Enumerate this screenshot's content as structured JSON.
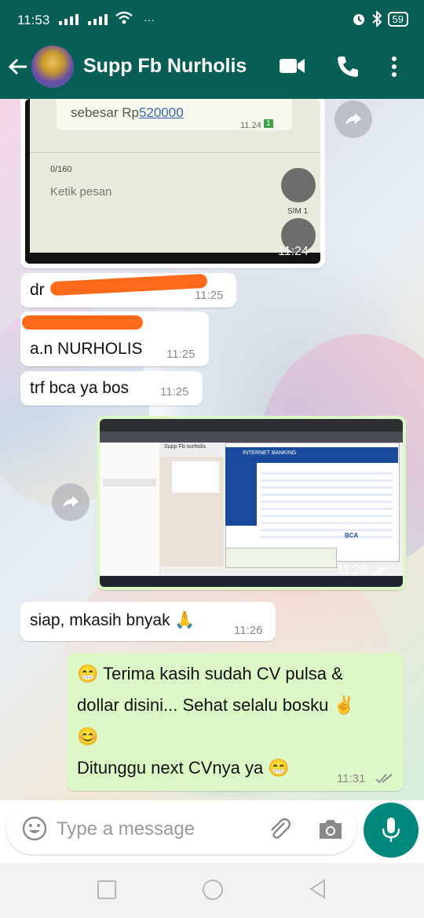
{
  "status_bar": {
    "time": "11:53",
    "battery": "59",
    "more": "···"
  },
  "header": {
    "contact_name": "Supp Fb Nurholis"
  },
  "colors": {
    "header": "#075e54",
    "outgoing_bubble": "#dcf8c6",
    "incoming_bubble": "#ffffff",
    "mic_button": "#00897b",
    "redaction": "#ff6a1a"
  },
  "messages": [
    {
      "type": "image",
      "direction": "incoming",
      "time": "11:24",
      "image_text": {
        "line1": "sebesar Rp",
        "amount": "520000",
        "msg_time": "11.24",
        "msg_badge": "1",
        "counter": "0/160",
        "placeholder": "Ketik pesan",
        "sim": "SIM 1"
      }
    },
    {
      "type": "text",
      "direction": "incoming",
      "text": "dr",
      "time": "11:25",
      "redacted": true
    },
    {
      "type": "text",
      "direction": "incoming",
      "text": "a.n NURHOLIS",
      "time": "11:25",
      "redacted": true
    },
    {
      "type": "text",
      "direction": "incoming",
      "text": "trf bca ya bos",
      "time": "11:25"
    },
    {
      "type": "image",
      "direction": "outgoing",
      "time": "11:26",
      "image_text": {
        "chat_title": "Supp Fb nurholis",
        "page_title": "INTERNET BANKING",
        "bank": "BCA"
      }
    },
    {
      "type": "text",
      "direction": "incoming",
      "text": "siap, mkasih bnyak 🙏",
      "time": "11:26"
    },
    {
      "type": "text",
      "direction": "outgoing",
      "time": "11:31",
      "line1": "😁 Terima kasih sudah CV pulsa &",
      "line2": "dollar disini... Sehat selalu bosku ✌",
      "line3": "😊",
      "line4": "Ditunggu next CVnya ya 😁"
    }
  ],
  "composer": {
    "placeholder": "Type a message"
  }
}
